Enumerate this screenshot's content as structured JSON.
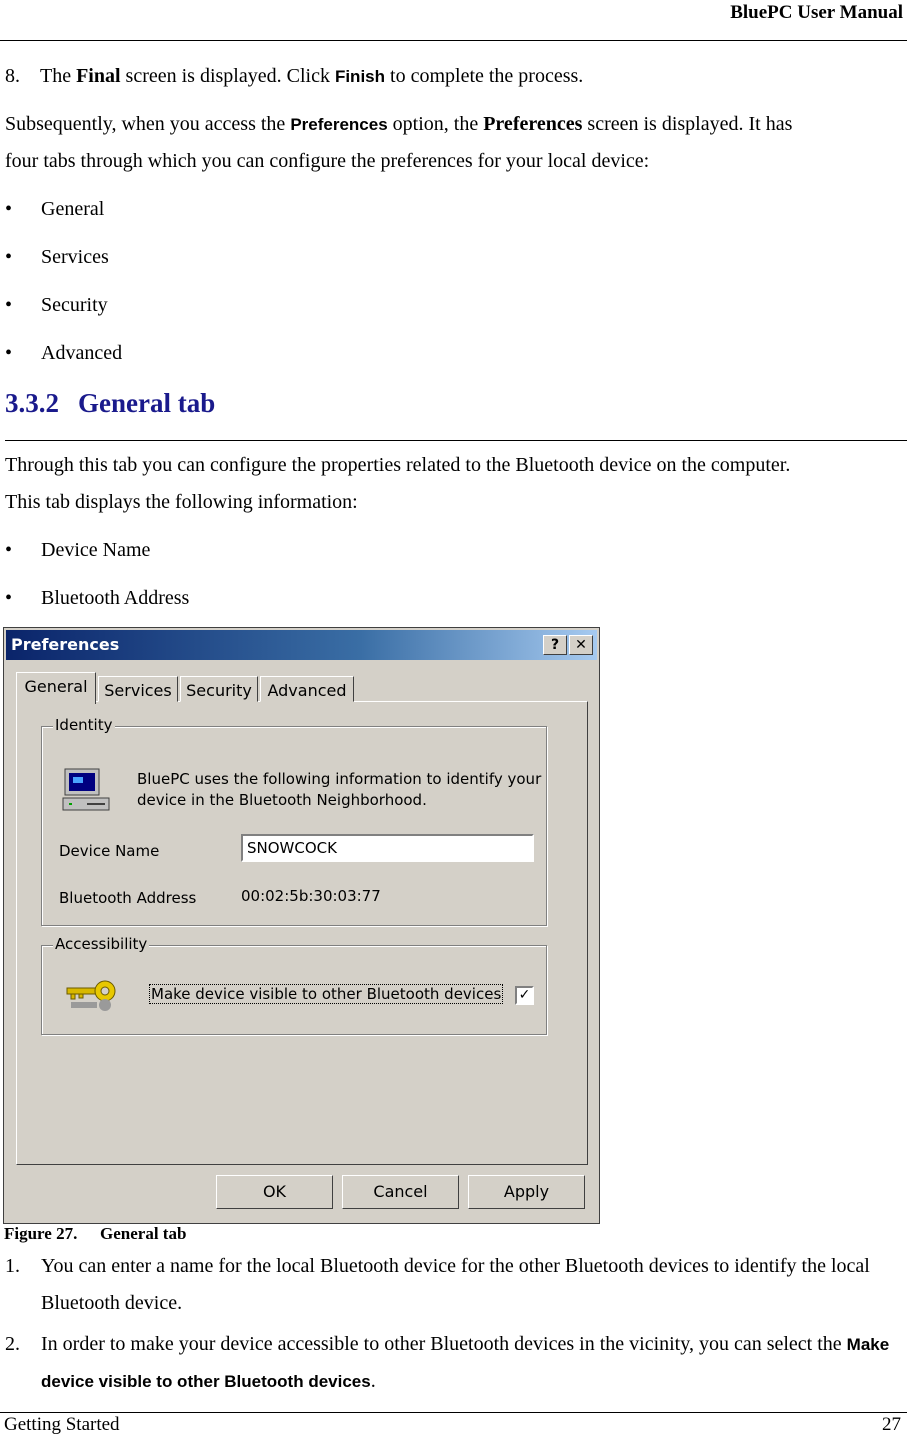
{
  "header": {
    "title": "BluePC User Manual"
  },
  "step8": {
    "number": "8.",
    "pre": "The ",
    "final": "Final",
    "mid": " screen is displayed. Click ",
    "finish": "Finish",
    "post": " to complete the process."
  },
  "prefs_para": {
    "line1_pre": "Subsequently, when you access the ",
    "pref_ui": "Preferences",
    "line1_mid": " option, the ",
    "pref_bold": "Preferences",
    "line1_post": " screen is displayed. It has",
    "line2": "four tabs through which you can configure the preferences for your local device:"
  },
  "bullets_tabs": [
    "General",
    "Services",
    "Security",
    "Advanced"
  ],
  "section": {
    "number": "3.3.2",
    "title": "General tab"
  },
  "general_para": {
    "line1": "Through this tab you can configure the properties related to the Bluetooth device on the computer.",
    "line2": "This tab displays the following information:"
  },
  "bullets_info": [
    "Device Name",
    "Bluetooth Address"
  ],
  "dialog": {
    "title": "Preferences",
    "help_btn": "?",
    "close_btn": "✕",
    "tabs": [
      "General",
      "Services",
      "Security",
      "Advanced"
    ],
    "identity": {
      "label": "Identity",
      "desc_line1": "BluePC uses the following information to identify your",
      "desc_line2": "device in the Bluetooth Neighborhood.",
      "device_name_label": "Device Name",
      "device_name_value": "SNOWCOCK",
      "address_label": "Bluetooth Address",
      "address_value": "00:02:5b:30:03:77"
    },
    "accessibility": {
      "label": "Accessibility",
      "visible_label": "Make device visible to other Bluetooth devices",
      "checked_mark": "✓"
    },
    "buttons": {
      "ok": "OK",
      "cancel": "Cancel",
      "apply": "Apply"
    }
  },
  "figure": {
    "label": "Figure 27.",
    "title": "General tab"
  },
  "numbered": {
    "item1": {
      "n": "1.",
      "text": "You can enter a name for the local Bluetooth device for the other Bluetooth devices to identify the local Bluetooth device."
    },
    "item2": {
      "n": "2.",
      "pre": "In order to make your device accessible to other Bluetooth devices in the vicinity, you can select the ",
      "ui": "Make device visible to other Bluetooth devices",
      "post": "."
    }
  },
  "footer": {
    "left": "Getting Started",
    "page": "27"
  }
}
